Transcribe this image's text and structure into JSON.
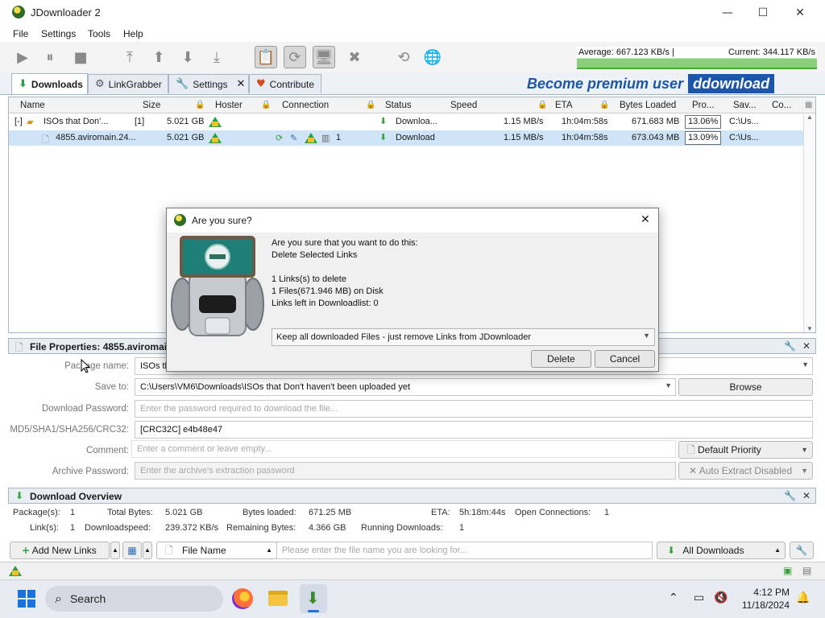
{
  "window": {
    "title": "JDownloader 2",
    "minimize": "—",
    "maximize": "☐",
    "close": "✕"
  },
  "menu": [
    "File",
    "Settings",
    "Tools",
    "Help"
  ],
  "speed": {
    "average": "Average: 667.123 KB/s |",
    "current": "Current: 344.117 KB/s"
  },
  "tabs": [
    {
      "label": "Downloads",
      "icon": "download-arrow-icon",
      "active": true
    },
    {
      "label": "LinkGrabber",
      "icon": "linkgrabber-icon"
    },
    {
      "label": "Settings",
      "icon": "wrench-icon",
      "closable": true
    },
    {
      "label": "Contribute",
      "icon": "heart-icon"
    }
  ],
  "premium": {
    "text": "Become premium user",
    "brand": "ddownload"
  },
  "table": {
    "columns": [
      "Name",
      "Size",
      "Hoster",
      "Connection",
      "Status",
      "Speed",
      "ETA",
      "Bytes Loaded",
      "Pro...",
      "Sav...",
      "Co..."
    ],
    "package": {
      "expander": "[-]",
      "name": "ISOs that Don'...",
      "count": "[1]",
      "size": "5.021 GB",
      "status": "Downloa...",
      "speed": "1.15 MB/s",
      "eta": "1h:04m:58s",
      "loaded": "671.683 MB",
      "progress": "13.06%",
      "save": "C:\\Us..."
    },
    "file": {
      "name": "4855.aviromain.24...",
      "size": "5.021 GB",
      "connections": "1",
      "status": "Download",
      "speed": "1.15 MB/s",
      "eta": "1h:04m:58s",
      "loaded": "673.043 MB",
      "progress": "13.09%",
      "save": "C:\\Us..."
    }
  },
  "fileprops": {
    "title": "File Properties: 4855.aviromain.24",
    "package_label": "Package name:",
    "package_value": "ISOs th",
    "saveto_label": "Save to:",
    "saveto_value": "C:\\Users\\VM6\\Downloads\\ISOs that Don't haven't been uploaded yet",
    "browse": "Browse",
    "pw_label": "Download Password:",
    "pw_placeholder": "Enter the password required to download the file...",
    "md5_label": "MD5/SHA1/SHA256/CRC32:",
    "md5_value": "[CRC32C] e4b48e47",
    "comment_label": "Comment:",
    "comment_placeholder": "Enter a comment or leave empty...",
    "priority": "Default Priority",
    "archive_label": "Archive Password:",
    "archive_placeholder": "Enter the archive's extraction password",
    "autoextract": "Auto Extract Disabled"
  },
  "overview": {
    "title": "Download Overview",
    "r1": {
      "packages_l": "Package(s):",
      "packages_v": "1",
      "total_l": "Total Bytes:",
      "total_v": "5.021 GB",
      "loaded_l": "Bytes loaded:",
      "loaded_v": "671.25 MB",
      "eta_l": "ETA:",
      "eta_v": "5h:18m:44s",
      "open_l": "Open Connections:",
      "open_v": "1"
    },
    "r2": {
      "links_l": "Link(s):",
      "links_v": "1",
      "dl_l": "Downloadspeed:",
      "dl_v": "239.372 KB/s",
      "rem_l": "Remaining Bytes:",
      "rem_v": "4.366 GB",
      "run_l": "Running Downloads:",
      "run_v": "1"
    }
  },
  "bottom": {
    "add_links": "Add New Links",
    "filename": "File Name",
    "search_placeholder": "Please enter the file name you are looking for...",
    "all_downloads": "All Downloads"
  },
  "dialog": {
    "title": "Are you sure?",
    "l1": "Are you sure that you want to do this:",
    "l2": "Delete Selected Links",
    "l3": "1 Links(s) to delete",
    "l4": "1 Files(671.946 MB) on Disk",
    "l5": "Links left in Downloadlist: 0",
    "option": "Keep all downloaded Files - just remove Links from JDownloader",
    "delete": "Delete",
    "cancel": "Cancel"
  },
  "taskbar": {
    "search": "Search",
    "time": "4:12 PM",
    "date": "11/18/2024"
  },
  "colors": {
    "accent": "#1b56a8",
    "selected_row": "#cfe4f7",
    "progress_green": "#8bcf7d"
  }
}
